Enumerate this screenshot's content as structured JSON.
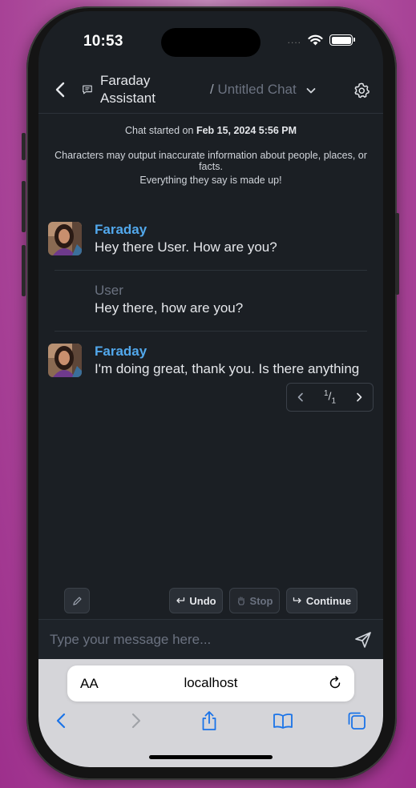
{
  "status_bar": {
    "time": "10:53",
    "signal": "...."
  },
  "header": {
    "title": "Faraday Assistant",
    "chat_prefix": "/ ",
    "chat_name": "Untitled Chat"
  },
  "info": {
    "started_prefix": "Chat started on",
    "started_date": "Feb 15, 2024 5:56 PM",
    "disclaimer": "Characters may output inaccurate information about people, places, or facts.",
    "made_up": "Everything they say is made up!"
  },
  "messages": [
    {
      "name": "Faraday",
      "text": "Hey there User. How are you?",
      "is_user": false
    },
    {
      "name": "User",
      "text": "Hey there, how are you?",
      "is_user": true
    },
    {
      "name": "Faraday",
      "text": "I'm doing great, thank you. Is there anything",
      "is_user": false
    }
  ],
  "pager": {
    "current": "1",
    "total": "1"
  },
  "actions": {
    "undo": "Undo",
    "stop": "Stop",
    "continue": "Continue"
  },
  "input": {
    "placeholder": "Type your message here...",
    "value": ""
  },
  "safari": {
    "aa_label": "AA",
    "url": "localhost"
  },
  "colors": {
    "accent": "#52a8ec",
    "background": "#1b1f24",
    "safari_blue": "#1a73e8"
  }
}
